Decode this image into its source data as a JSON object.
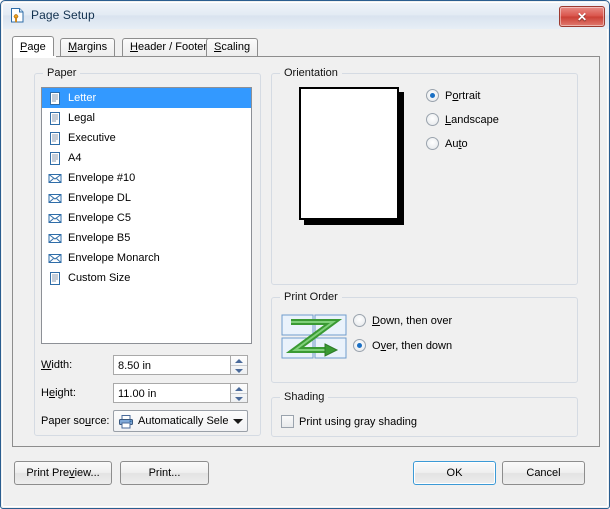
{
  "window": {
    "title": "Page Setup",
    "icon": "page-setup-icon",
    "close_label": "✕"
  },
  "tabs": [
    {
      "label": "Page",
      "accel": "P",
      "active": true
    },
    {
      "label": "Margins",
      "accel": "M",
      "active": false
    },
    {
      "label": "Header / Footer",
      "accel": "H",
      "active": false
    },
    {
      "label": "Scaling",
      "accel": "S",
      "active": false
    }
  ],
  "paper": {
    "group_title": "Paper",
    "items": [
      {
        "label": "Letter",
        "icon": "page-icon",
        "selected": true
      },
      {
        "label": "Legal",
        "icon": "page-icon",
        "selected": false
      },
      {
        "label": "Executive",
        "icon": "page-icon",
        "selected": false
      },
      {
        "label": "A4",
        "icon": "page-icon",
        "selected": false
      },
      {
        "label": "Envelope #10",
        "icon": "envelope-icon",
        "selected": false
      },
      {
        "label": "Envelope DL",
        "icon": "envelope-icon",
        "selected": false
      },
      {
        "label": "Envelope C5",
        "icon": "envelope-icon",
        "selected": false
      },
      {
        "label": "Envelope B5",
        "icon": "envelope-icon",
        "selected": false
      },
      {
        "label": "Envelope Monarch",
        "icon": "envelope-icon",
        "selected": false
      },
      {
        "label": "Custom Size",
        "icon": "page-icon",
        "selected": false
      }
    ],
    "width": {
      "label": "Width:",
      "accel": "W",
      "value": "8.50 in"
    },
    "height": {
      "label": "Height:",
      "accel": "e",
      "value": "11.00 in"
    },
    "source": {
      "label": "Paper source:",
      "accel": "u",
      "value": "Automatically Select",
      "icon": "printer-icon"
    }
  },
  "orientation": {
    "group_title": "Orientation",
    "preview": "portrait-page-preview",
    "options": [
      {
        "label": "Portrait",
        "accel": "o",
        "checked": true
      },
      {
        "label": "Landscape",
        "accel": "L",
        "checked": false
      },
      {
        "label": "Auto",
        "accel": "t",
        "checked": false
      }
    ]
  },
  "print_order": {
    "group_title": "Print Order",
    "icon": "print-order-z-icon",
    "options": [
      {
        "label": "Down, then over",
        "accel": "D",
        "checked": false
      },
      {
        "label": "Over, then down",
        "accel": "v",
        "checked": true
      }
    ]
  },
  "shading": {
    "group_title": "Shading",
    "checkbox": {
      "label": "Print using gray shading",
      "accel": "g",
      "checked": false
    }
  },
  "buttons": {
    "print_preview": {
      "label": "Print Preview...",
      "accel": "v"
    },
    "print": {
      "label": "Print...",
      "accel": ""
    },
    "ok": {
      "label": "OK",
      "default": true
    },
    "cancel": {
      "label": "Cancel",
      "default": false
    }
  },
  "colors": {
    "selection_blue": "#3399ff",
    "title_text": "#12314f",
    "accent_green": "#3a9a33",
    "close_red": "#cb3f35",
    "focus_blue": "#3c9ad6"
  }
}
